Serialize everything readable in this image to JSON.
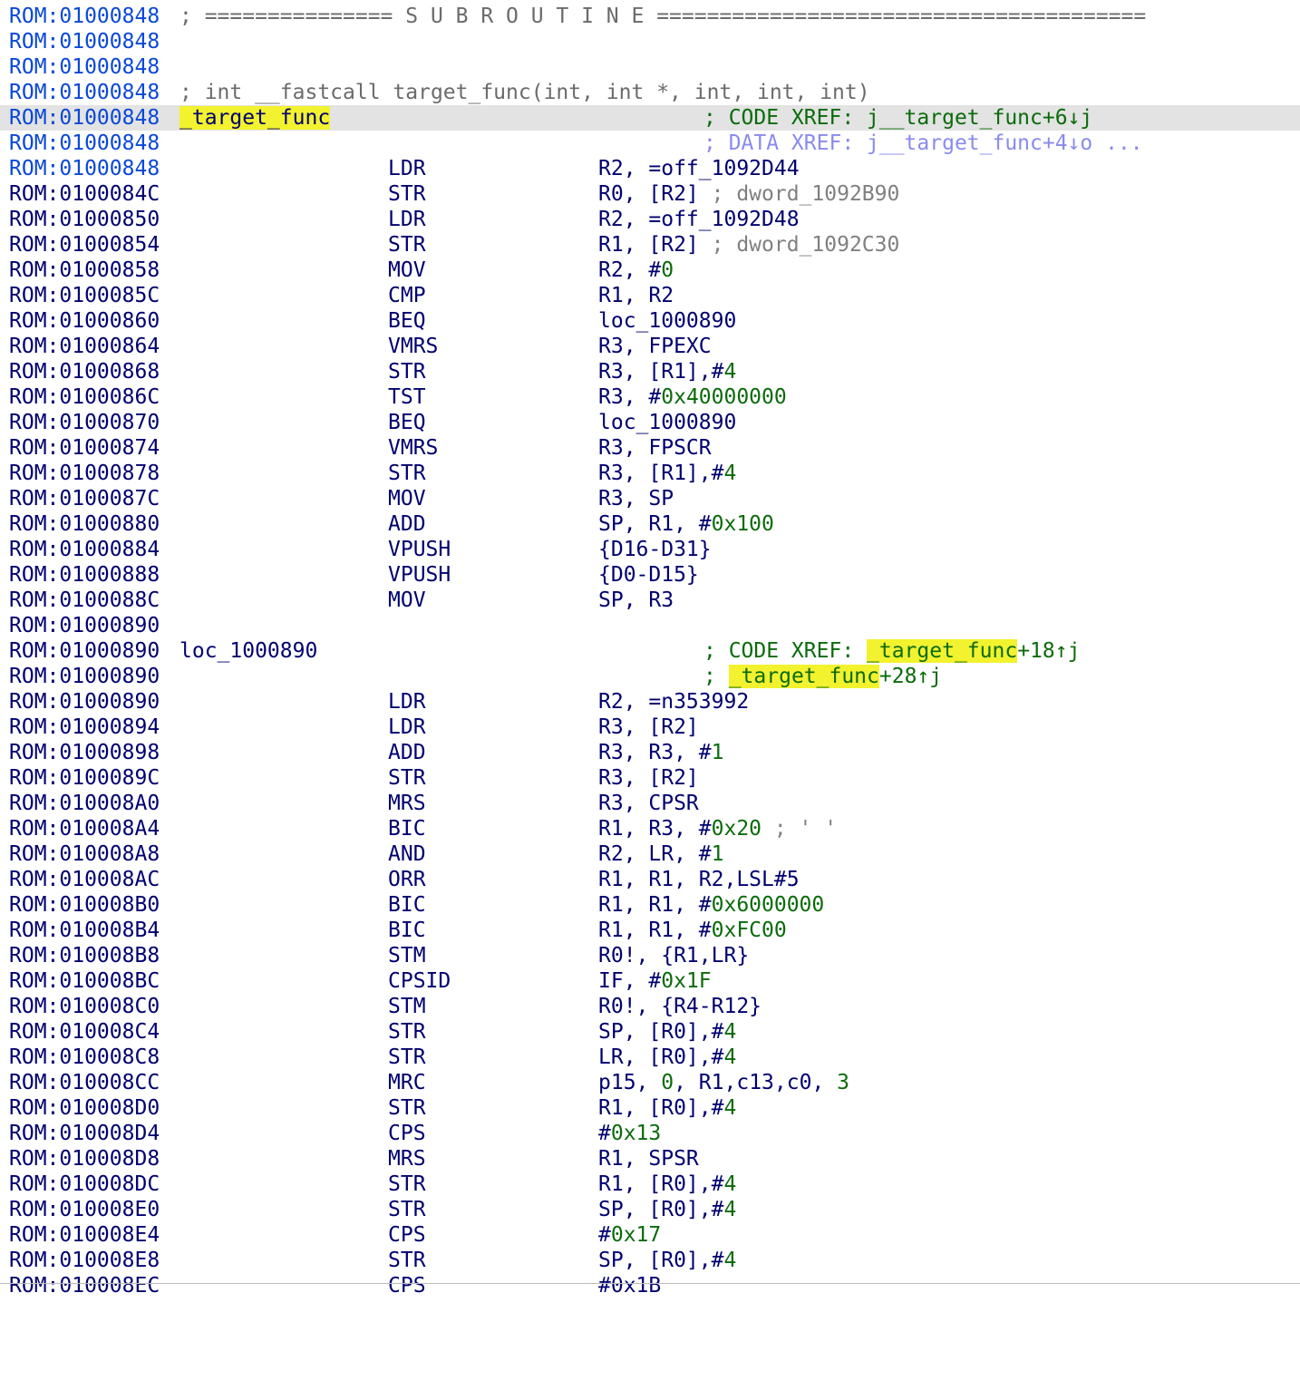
{
  "header": {
    "addr": "ROM:01000848",
    "banner": "; =============== S U B R O U T I N E ======================================="
  },
  "blank_addr": "ROM:01000848",
  "prototype": "; int __fastcall target_func(int, int *, int, int, int)",
  "func": {
    "addr": "ROM:01000848",
    "label": "_target_func",
    "xref1": "; CODE XREF: j__target_func+6↓j",
    "xref2": "; DATA XREF: j__target_func+4↓o ..."
  },
  "instructions_a": [
    {
      "addr": "ROM:01000848",
      "mn": "LDR",
      "op": "R2, =off_1092D44"
    },
    {
      "addr": "ROM:0100084C",
      "mn": "STR",
      "op": "R0, [R2]",
      "cmt": "; dword_1092B90"
    },
    {
      "addr": "ROM:01000850",
      "mn": "LDR",
      "op": "R2, =off_1092D48"
    },
    {
      "addr": "ROM:01000854",
      "mn": "STR",
      "op": "R1, [R2]",
      "cmt": "; dword_1092C30"
    },
    {
      "addr": "ROM:01000858",
      "mn": "MOV",
      "op": "R2, #",
      "imm": "0"
    },
    {
      "addr": "ROM:0100085C",
      "mn": "CMP",
      "op": "R1, R2"
    },
    {
      "addr": "ROM:01000860",
      "mn": "BEQ",
      "op": "loc_1000890"
    },
    {
      "addr": "ROM:01000864",
      "mn": "VMRS",
      "op": "R3, FPEXC"
    },
    {
      "addr": "ROM:01000868",
      "mn": "STR",
      "op": "R3, [R1],#",
      "imm": "4"
    },
    {
      "addr": "ROM:0100086C",
      "mn": "TST",
      "op": "R3, #",
      "imm": "0x40000000"
    },
    {
      "addr": "ROM:01000870",
      "mn": "BEQ",
      "op": "loc_1000890"
    },
    {
      "addr": "ROM:01000874",
      "mn": "VMRS",
      "op": "R3, FPSCR"
    },
    {
      "addr": "ROM:01000878",
      "mn": "STR",
      "op": "R3, [R1],#",
      "imm": "4"
    },
    {
      "addr": "ROM:0100087C",
      "mn": "MOV",
      "op": "R3, SP"
    },
    {
      "addr": "ROM:01000880",
      "mn": "ADD",
      "op": "SP, R1, #",
      "imm": "0x100"
    },
    {
      "addr": "ROM:01000884",
      "mn": "VPUSH",
      "op": "{D16-D31}"
    },
    {
      "addr": "ROM:01000888",
      "mn": "VPUSH",
      "op": "{D0-D15}"
    },
    {
      "addr": "ROM:0100088C",
      "mn": "MOV",
      "op": "SP, R3"
    }
  ],
  "loc": {
    "blank_addr": "ROM:01000890",
    "addr": "ROM:01000890",
    "label": "loc_1000890",
    "xref1_pre": "; CODE XREF: ",
    "xref1_hl": "_target_func",
    "xref1_post": "+18↑j",
    "xref2_addr": "ROM:01000890",
    "xref2_pre": "; ",
    "xref2_hl": "_target_func",
    "xref2_post": "+28↑j"
  },
  "instructions_b": [
    {
      "addr": "ROM:01000890",
      "mn": "LDR",
      "op": "R2, =n353992"
    },
    {
      "addr": "ROM:01000894",
      "mn": "LDR",
      "op": "R3, [R2]"
    },
    {
      "addr": "ROM:01000898",
      "mn": "ADD",
      "op": "R3, R3, #",
      "imm": "1"
    },
    {
      "addr": "ROM:0100089C",
      "mn": "STR",
      "op": "R3, [R2]"
    },
    {
      "addr": "ROM:010008A0",
      "mn": "MRS",
      "op": "R3, CPSR"
    },
    {
      "addr": "ROM:010008A4",
      "mn": "BIC",
      "op": "R1, R3, #",
      "imm": "0x20",
      "cmt": " ; ' '"
    },
    {
      "addr": "ROM:010008A8",
      "mn": "AND",
      "op": "R2, LR, #",
      "imm": "1"
    },
    {
      "addr": "ROM:010008AC",
      "mn": "ORR",
      "op": "R1, R1, R2,LSL#5"
    },
    {
      "addr": "ROM:010008B0",
      "mn": "BIC",
      "op": "R1, R1, #",
      "imm": "0x6000000"
    },
    {
      "addr": "ROM:010008B4",
      "mn": "BIC",
      "op": "R1, R1, #",
      "imm": "0xFC00"
    },
    {
      "addr": "ROM:010008B8",
      "mn": "STM",
      "op": "R0!, {R1,LR}"
    },
    {
      "addr": "ROM:010008BC",
      "mn": "CPSID",
      "op": "IF, #",
      "imm": "0x1F"
    },
    {
      "addr": "ROM:010008C0",
      "mn": "STM",
      "op": "R0!, {R4-R12}"
    },
    {
      "addr": "ROM:010008C4",
      "mn": "STR",
      "op": "SP, [R0],#",
      "imm": "4"
    },
    {
      "addr": "ROM:010008C8",
      "mn": "STR",
      "op": "LR, [R0],#",
      "imm": "4"
    },
    {
      "addr": "ROM:010008CC",
      "mn": "MRC",
      "op": "p15, ",
      "imm": "0",
      "op2": ", R1,c13,c0, ",
      "imm2": "3"
    },
    {
      "addr": "ROM:010008D0",
      "mn": "STR",
      "op": "R1, [R0],#",
      "imm": "4"
    },
    {
      "addr": "ROM:010008D4",
      "mn": "CPS",
      "op": "#",
      "imm": "0x13"
    },
    {
      "addr": "ROM:010008D8",
      "mn": "MRS",
      "op": "R1, SPSR"
    },
    {
      "addr": "ROM:010008DC",
      "mn": "STR",
      "op": "R1, [R0],#",
      "imm": "4"
    },
    {
      "addr": "ROM:010008E0",
      "mn": "STR",
      "op": "SP, [R0],#",
      "imm": "4"
    },
    {
      "addr": "ROM:010008E4",
      "mn": "CPS",
      "op": "#",
      "imm": "0x17"
    },
    {
      "addr": "ROM:010008E8",
      "mn": "STR",
      "op": "SP, [R0],#",
      "imm": "4"
    }
  ],
  "partial": {
    "addr": "ROM:010008EC",
    "mn": "CPS",
    "op": "#0x1B"
  }
}
